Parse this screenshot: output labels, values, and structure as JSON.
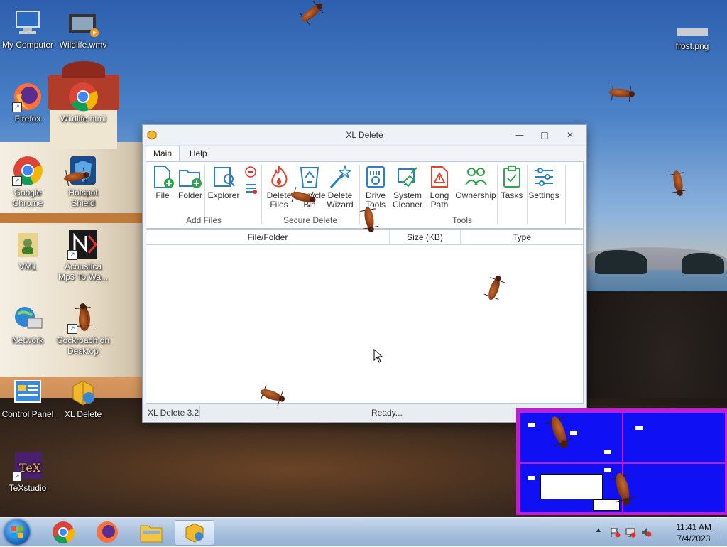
{
  "desktop": {
    "icons": [
      {
        "label": "My Computer",
        "icon": "computer-icon"
      },
      {
        "label": "Wildlife.wmv",
        "icon": "video-file-icon"
      },
      {
        "label": "Firefox",
        "icon": "firefox-icon"
      },
      {
        "label": "Wildlife.html",
        "icon": "chrome-html-icon"
      },
      {
        "label": "Google Chrome",
        "icon": "chrome-icon"
      },
      {
        "label": "Hotspot Shield",
        "icon": "hotspot-shield-icon"
      },
      {
        "label": "VM1",
        "icon": "vm-folder-icon"
      },
      {
        "label": "Acoustica Mp3 To Wa...",
        "icon": "acoustica-icon"
      },
      {
        "label": "Network",
        "icon": "network-icon"
      },
      {
        "label": "Cockroach on Desktop",
        "icon": "cockroach-icon"
      },
      {
        "label": "Control Panel",
        "icon": "control-panel-icon"
      },
      {
        "label": "XL Delete",
        "icon": "xl-delete-icon"
      },
      {
        "label": "TeXstudio",
        "icon": "texstudio-icon"
      },
      {
        "label": "frost.png",
        "icon": "image-file-icon"
      }
    ]
  },
  "window": {
    "title": "XL Delete",
    "controls": {
      "minimize": "—",
      "maximize": "□",
      "close": "✕"
    },
    "tabs": [
      {
        "label": "Main",
        "active": true
      },
      {
        "label": "Help",
        "active": false
      }
    ],
    "ribbon": {
      "add_files": {
        "group_label": "Add Files",
        "buttons": [
          {
            "label1": "File",
            "label2": "",
            "icon": "file-add-icon"
          },
          {
            "label1": "Folder",
            "label2": "",
            "icon": "folder-add-icon"
          },
          {
            "label1": "Explorer",
            "label2": "",
            "icon": "explorer-icon"
          }
        ]
      },
      "secure_delete": {
        "group_label": "Secure Delete",
        "buttons": [
          {
            "label1": "Delete",
            "label2": "Files",
            "icon": "fire-delete-icon"
          },
          {
            "label1": "Recycle",
            "label2": "Bin",
            "icon": "recycle-bin-icon"
          },
          {
            "label1": "Delete",
            "label2": "Wizard",
            "icon": "magic-wand-icon"
          }
        ]
      },
      "tools": {
        "group_label": "Tools",
        "buttons": [
          {
            "label1": "Drive",
            "label2": "Tools",
            "icon": "drive-tools-icon"
          },
          {
            "label1": "System",
            "label2": "Cleaner",
            "icon": "system-cleaner-icon"
          },
          {
            "label1": "Long",
            "label2": "Path",
            "icon": "long-path-icon"
          },
          {
            "label1": "Ownership",
            "label2": "",
            "icon": "ownership-icon"
          },
          {
            "label1": "Tasks",
            "label2": "",
            "icon": "tasks-icon"
          },
          {
            "label1": "Settings",
            "label2": "",
            "icon": "settings-icon"
          }
        ]
      }
    },
    "list": {
      "columns": [
        "File/Folder",
        "Size (KB)",
        "Type"
      ],
      "rows": []
    },
    "status": {
      "version": "XL Delete 3.2",
      "message": "Ready..."
    }
  },
  "taskbar": {
    "pinned": [
      {
        "name": "chrome",
        "icon": "chrome-icon"
      },
      {
        "name": "firefox",
        "icon": "firefox-icon"
      },
      {
        "name": "explorer",
        "icon": "file-explorer-icon"
      },
      {
        "name": "xl-delete",
        "icon": "xl-delete-icon",
        "active": true
      }
    ],
    "clock": {
      "time": "11:41 AM",
      "date": "7/4/2023"
    }
  }
}
